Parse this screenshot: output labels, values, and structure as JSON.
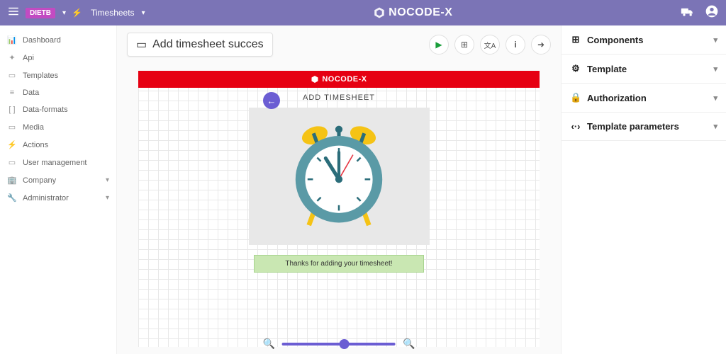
{
  "topbar": {
    "workspace_badge": "DIETB",
    "breadcrumb_label": "Timesheets",
    "brand": "NOCODE-X"
  },
  "sidebar": {
    "items": [
      {
        "icon": "📊",
        "label": "Dashboard"
      },
      {
        "icon": "✦",
        "label": "Api"
      },
      {
        "icon": "▭",
        "label": "Templates"
      },
      {
        "icon": "≡",
        "label": "Data"
      },
      {
        "icon": "[ ]",
        "label": "Data-formats"
      },
      {
        "icon": "▭",
        "label": "Media"
      },
      {
        "icon": "⚡",
        "label": "Actions"
      },
      {
        "icon": "▭",
        "label": "User management"
      },
      {
        "icon": "🏢",
        "label": "Company",
        "expandable": true
      },
      {
        "icon": "🔧",
        "label": "Administrator",
        "expandable": true
      }
    ]
  },
  "page": {
    "title": "Add timesheet succes",
    "canvas_header": "NOCODE-X",
    "canvas_subtitle": "ADD TIMESHEET",
    "success_message": "Thanks for adding your timesheet!"
  },
  "right_panel": {
    "items": [
      {
        "icon": "⊞",
        "label": "Components"
      },
      {
        "icon": "⚙",
        "label": "Template"
      },
      {
        "icon": "🔒",
        "label": "Authorization"
      },
      {
        "icon": "‹·›",
        "label": "Template parameters"
      }
    ]
  },
  "zoom": {
    "value": 55
  }
}
